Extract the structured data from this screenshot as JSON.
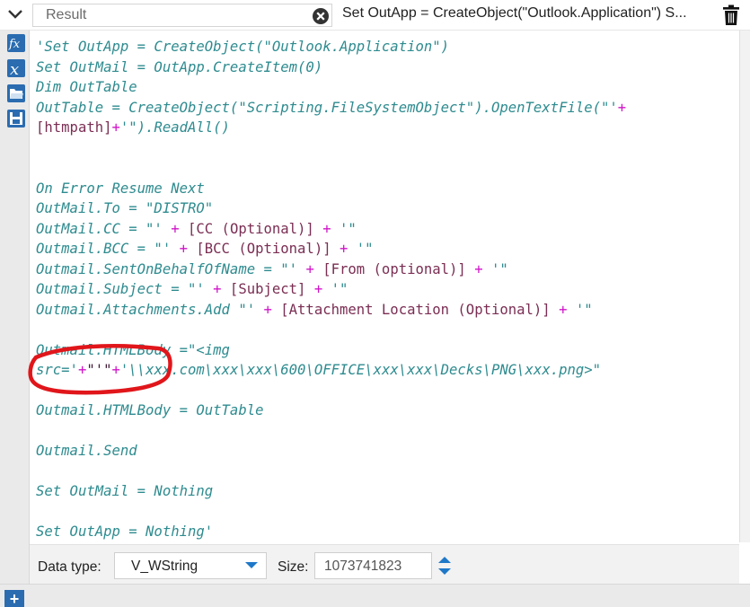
{
  "header": {
    "name_value": "Result",
    "expression_preview": "Set OutApp = CreateObject(\"Outlook.Application\") S..."
  },
  "code_lines": [
    {
      "segments": [
        {
          "t": "'Set OutApp = CreateObject(\"Outlook.Application\")",
          "c": "teal"
        }
      ]
    },
    {
      "segments": [
        {
          "t": "Set OutMail = OutApp.CreateItem(0)",
          "c": "teal"
        }
      ]
    },
    {
      "segments": [
        {
          "t": "Dim OutTable",
          "c": "teal"
        }
      ]
    },
    {
      "segments": [
        {
          "t": "OutTable = CreateObject(\"Scripting.FileSystemObject\").OpenTextFile(\"'",
          "c": "teal"
        },
        {
          "t": "+",
          "c": "mag"
        }
      ]
    },
    {
      "segments": [
        {
          "t": "[htmpath]",
          "c": "dark"
        },
        {
          "t": "+",
          "c": "mag"
        },
        {
          "t": "'\").ReadAll()",
          "c": "teal"
        }
      ]
    },
    {
      "segments": []
    },
    {
      "segments": []
    },
    {
      "segments": [
        {
          "t": "On Error Resume Next",
          "c": "teal"
        }
      ]
    },
    {
      "segments": [
        {
          "t": "OutMail.To = \"DISTRO\"",
          "c": "teal"
        }
      ]
    },
    {
      "segments": [
        {
          "t": "OutMail.CC = \"' ",
          "c": "teal"
        },
        {
          "t": "+",
          "c": "mag"
        },
        {
          "t": " [CC (Optional)] ",
          "c": "dark"
        },
        {
          "t": "+",
          "c": "mag"
        },
        {
          "t": " '\"",
          "c": "teal"
        }
      ]
    },
    {
      "segments": [
        {
          "t": "Outmail.BCC = \"' ",
          "c": "teal"
        },
        {
          "t": "+",
          "c": "mag"
        },
        {
          "t": " [BCC (Optional)] ",
          "c": "dark"
        },
        {
          "t": "+",
          "c": "mag"
        },
        {
          "t": " '\"",
          "c": "teal"
        }
      ]
    },
    {
      "segments": [
        {
          "t": "Outmail.SentOnBehalfOfName = \"' ",
          "c": "teal"
        },
        {
          "t": "+",
          "c": "mag"
        },
        {
          "t": " [From (optional)] ",
          "c": "dark"
        },
        {
          "t": "+",
          "c": "mag"
        },
        {
          "t": " '\"",
          "c": "teal"
        }
      ]
    },
    {
      "segments": [
        {
          "t": "Outmail.Subject = \"' ",
          "c": "teal"
        },
        {
          "t": "+",
          "c": "mag"
        },
        {
          "t": " [Subject] ",
          "c": "dark"
        },
        {
          "t": "+",
          "c": "mag"
        },
        {
          "t": " '\"",
          "c": "teal"
        }
      ]
    },
    {
      "segments": [
        {
          "t": "Outmail.Attachments.Add \"' ",
          "c": "teal"
        },
        {
          "t": "+",
          "c": "mag"
        },
        {
          "t": " [Attachment Location (Optional)] ",
          "c": "dark"
        },
        {
          "t": "+",
          "c": "mag"
        },
        {
          "t": " '\"",
          "c": "teal"
        }
      ]
    },
    {
      "segments": []
    },
    {
      "segments": [
        {
          "t": "Outmail.HTMLBody =\"<img",
          "c": "teal"
        }
      ]
    },
    {
      "segments": [
        {
          "t": "src='",
          "c": "teal"
        },
        {
          "t": "+",
          "c": "mag"
        },
        {
          "t": "\"'\"",
          "c": "blk"
        },
        {
          "t": "+",
          "c": "mag"
        },
        {
          "t": "'\\\\xxx.com\\xxx\\xxx\\600\\OFFICE\\xxx\\xxx\\Decks\\PNG\\xxx.png>\"",
          "c": "teal"
        }
      ]
    },
    {
      "segments": []
    },
    {
      "segments": [
        {
          "t": "Outmail.HTMLBody = OutTable",
          "c": "teal"
        }
      ]
    },
    {
      "segments": []
    },
    {
      "segments": [
        {
          "t": "Outmail.Send",
          "c": "teal"
        }
      ]
    },
    {
      "segments": []
    },
    {
      "segments": [
        {
          "t": "Set OutMail = Nothing",
          "c": "teal"
        }
      ]
    },
    {
      "segments": []
    },
    {
      "segments": [
        {
          "t": "Set OutApp = Nothing'",
          "c": "teal"
        }
      ]
    }
  ],
  "bottom": {
    "data_type_label": "Data type:",
    "data_type_value": "V_WString",
    "size_label": "Size:",
    "size_value": "1073741823"
  },
  "icons": {
    "collapse": "chevron-down-icon",
    "clear": "clear-circle-x-icon",
    "delete": "trash-icon",
    "functions": "fx-function-icon",
    "variables": "x-variable-icon",
    "open": "folder-open-icon",
    "save": "save-disk-icon",
    "add": "plus-icon"
  },
  "colors": {
    "keyword_teal": "#2e8b8f",
    "operator_magenta": "#d113c8",
    "field_dark": "#7a2e53",
    "toolbar_blue": "#2b6cb0",
    "annotation_red": "#e0161b"
  }
}
